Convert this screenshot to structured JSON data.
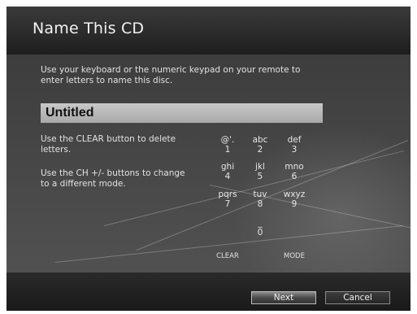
{
  "dialog": {
    "title": "Name This CD",
    "instruction": "Use your keyboard or the numeric keypad on your remote to enter letters to name this disc.",
    "name_value": "Untitled",
    "hint_clear": "Use the CLEAR button to delete letters.",
    "hint_mode": "Use the CH +/- buttons to change to a different mode."
  },
  "keypad": {
    "keys": [
      {
        "letters": "@'.",
        "number": "1"
      },
      {
        "letters": "abc",
        "number": "2"
      },
      {
        "letters": "def",
        "number": "3"
      },
      {
        "letters": "ghi",
        "number": "4"
      },
      {
        "letters": "jkl",
        "number": "5"
      },
      {
        "letters": "mno",
        "number": "6"
      },
      {
        "letters": "pqrs",
        "number": "7"
      },
      {
        "letters": "tuv",
        "number": "8"
      },
      {
        "letters": "wxyz",
        "number": "9"
      },
      {
        "letters": "_",
        "number": "0"
      }
    ],
    "clear_label": "CLEAR",
    "mode_label": "MODE"
  },
  "buttons": {
    "next_label": "Next",
    "cancel_label": "Cancel"
  }
}
